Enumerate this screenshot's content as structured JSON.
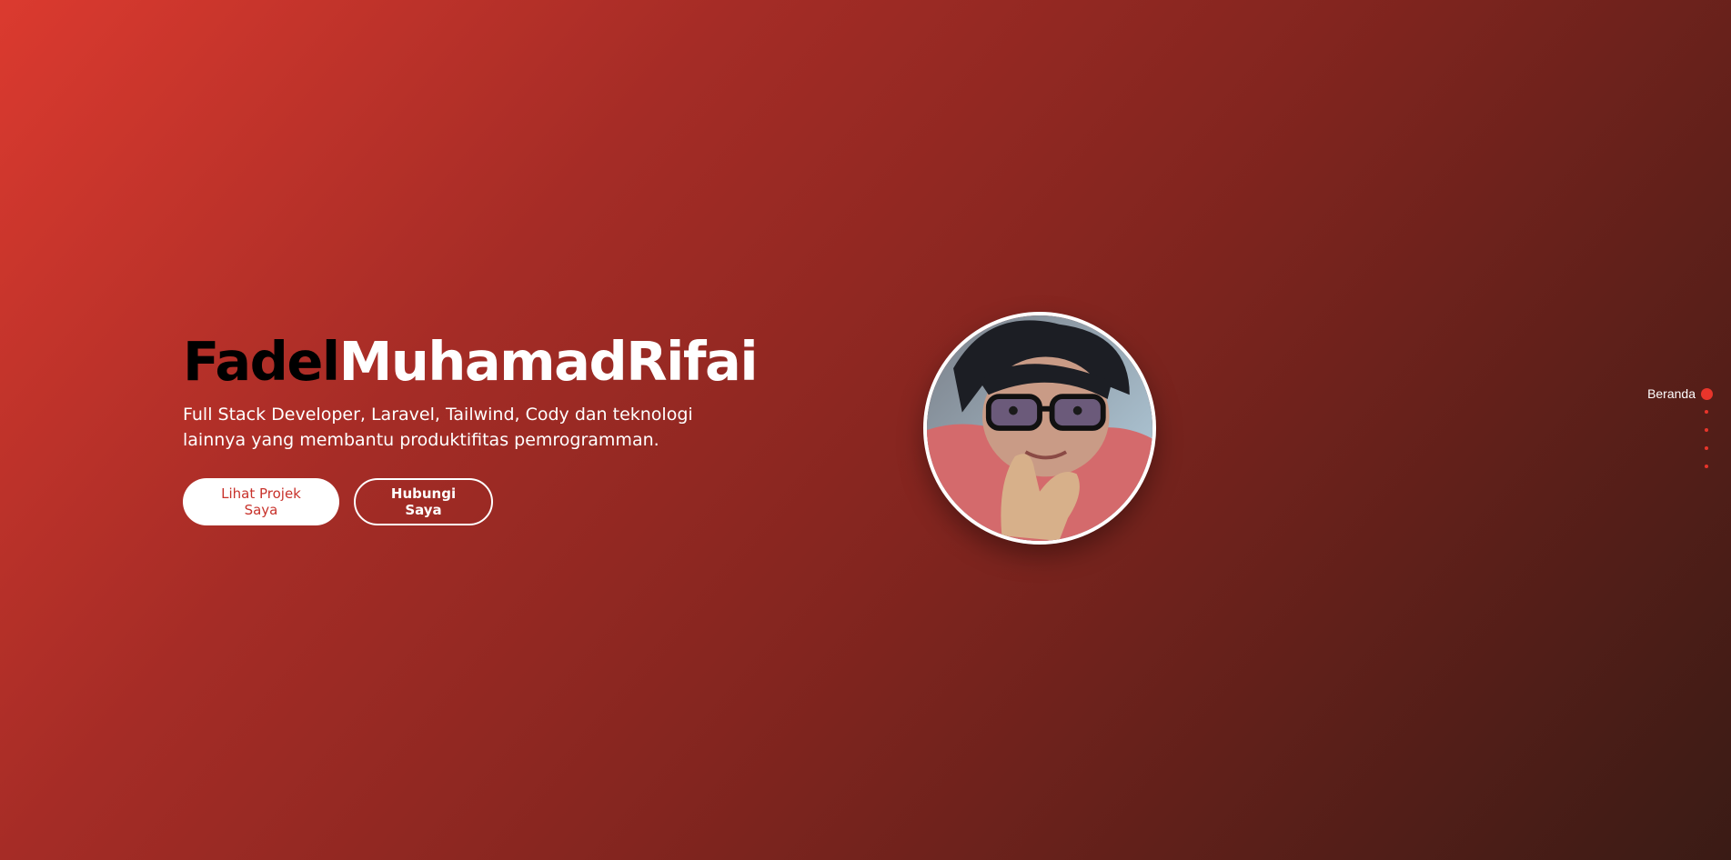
{
  "hero": {
    "title_first": "Fadel",
    "title_last": "MuhamadRifai",
    "subtitle": "Full Stack Developer, Laravel, Tailwind, Cody dan teknologi lainnya yang membantu produktifitas pemrogramman.",
    "primary_button": "Lihat Projek Saya",
    "secondary_button": "Hubungi Saya"
  },
  "side_nav": {
    "items": [
      {
        "label": "Beranda",
        "active": true
      },
      {
        "label": "",
        "active": false
      },
      {
        "label": "",
        "active": false
      },
      {
        "label": "",
        "active": false
      },
      {
        "label": "",
        "active": false
      }
    ]
  },
  "colors": {
    "gradient_start": "#db3a2f",
    "gradient_end": "#3a1b15",
    "accent": "#e8352b",
    "primary_button_text": "#c8322b"
  },
  "avatar": {
    "icon": "profile-photo"
  }
}
